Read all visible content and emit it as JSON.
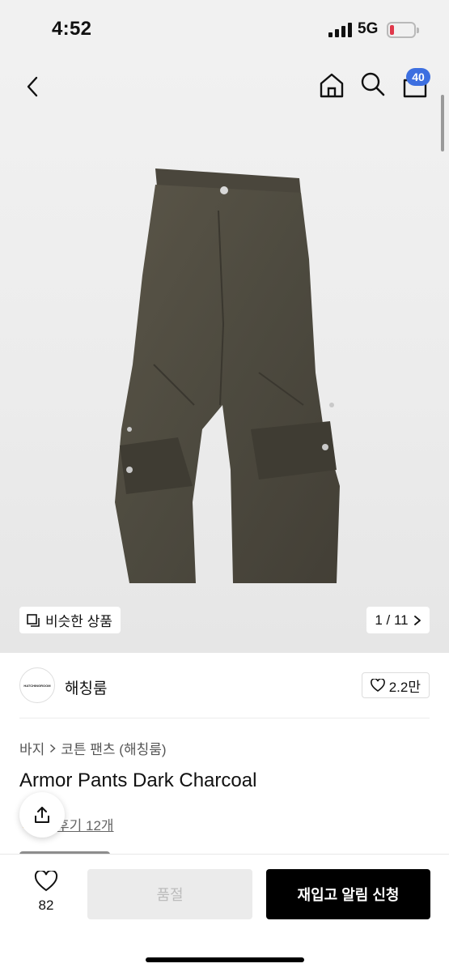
{
  "status_bar": {
    "time": "4:52",
    "network": "5G"
  },
  "header": {
    "back_icon": "chevron-left-icon",
    "home_icon": "home-icon",
    "search_icon": "search-icon",
    "cart_icon": "shopping-bag-icon",
    "cart_count": "40"
  },
  "gallery": {
    "similar_label": "비슷한 상품",
    "counter": "1 / 11",
    "accent": "#3d6fe0"
  },
  "seller": {
    "name": "해칭룸",
    "logo_text": "HATCHINGROOM",
    "likes": "2.2만"
  },
  "product": {
    "breadcrumb": [
      "바지",
      "코튼 팬츠 (해칭룸)"
    ],
    "title": "Armor Pants Dark Charcoal",
    "reviews": "후기 12개"
  },
  "bottom_bar": {
    "wish_count": "82",
    "soldout_label": "품절",
    "restock_label": "재입고 알림 신청"
  }
}
